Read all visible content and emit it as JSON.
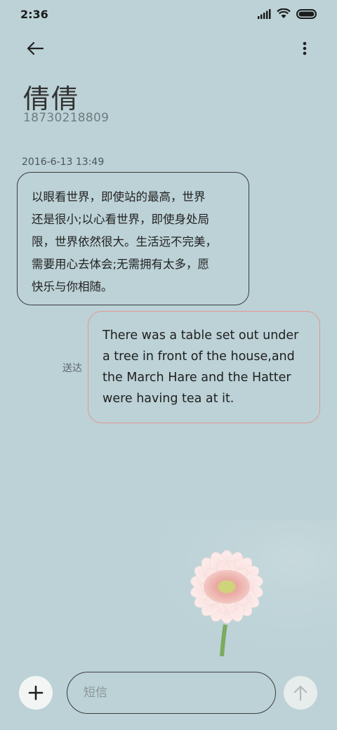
{
  "status_bar": {
    "time": "2:36",
    "icons": [
      "signal-icon",
      "wifi-icon",
      "battery-icon"
    ]
  },
  "header": {
    "back_icon": "arrow-left-icon",
    "more_icon": "more-vertical-icon"
  },
  "contact": {
    "name": "倩倩",
    "number": "18730218809"
  },
  "conversation": {
    "timestamp": "2016-6-13 13:49",
    "messages": [
      {
        "direction": "incoming",
        "lines": [
          "以眼看世界，即使站的最高，世界",
          "还是很小;以心看世界，即使身处局",
          "限，世界依然很大。生活远不完美，",
          "需要用心去体会;无需拥有太多，愿",
          "快乐与你相随。"
        ]
      },
      {
        "direction": "outgoing",
        "status": "送达",
        "lines": [
          "There was a table set out under",
          "a tree in front of the house,and",
          "the March Hare and the Hatter",
          "were having tea at it."
        ]
      }
    ]
  },
  "composer": {
    "add_icon": "plus-icon",
    "placeholder": "短信",
    "send_icon": "arrow-up-icon"
  },
  "colors": {
    "background": "#bcd2d7",
    "incoming_border": "#3b3b3b",
    "outgoing_border": "#e3978f"
  }
}
